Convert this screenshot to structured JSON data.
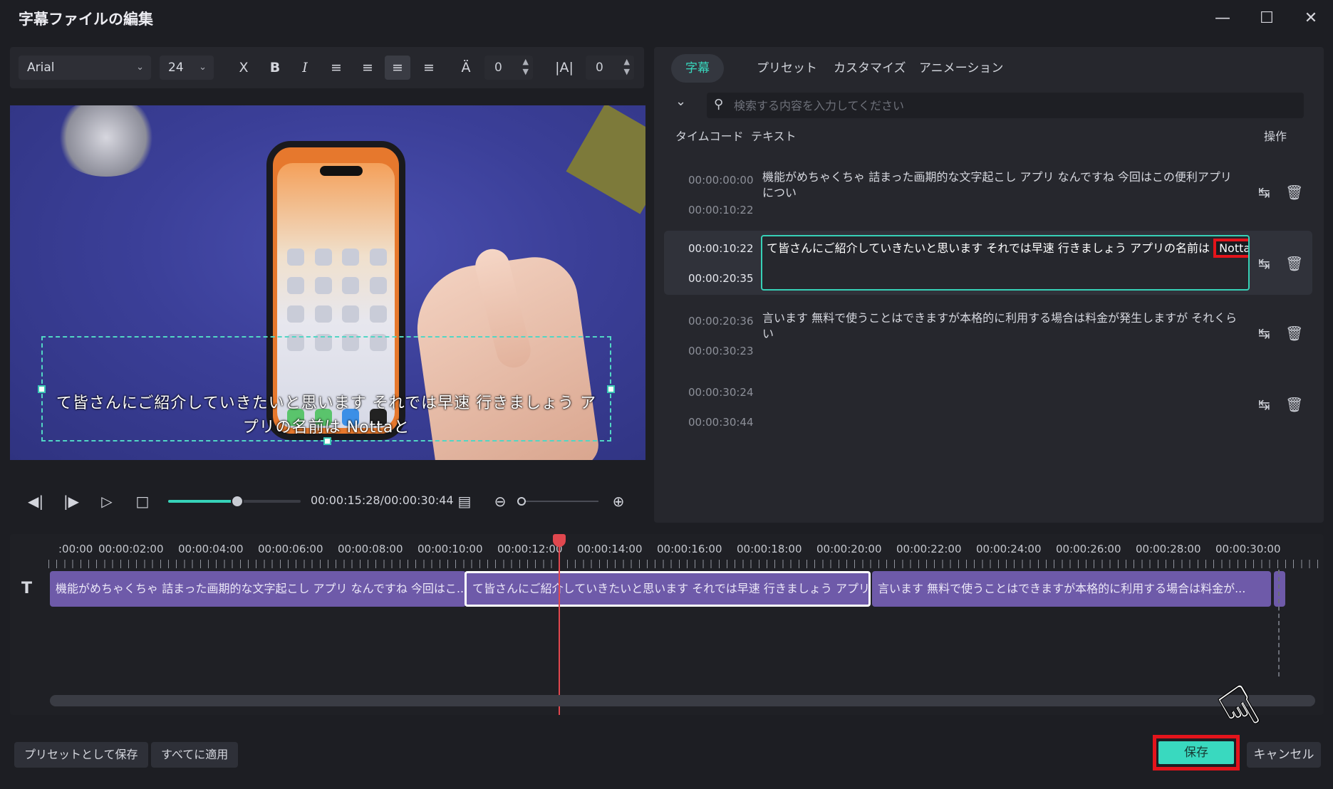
{
  "window": {
    "title": "字幕ファイルの編集"
  },
  "toolbar": {
    "font": "Arial",
    "size": "24",
    "letter_spacing": "0",
    "line_spacing": "0"
  },
  "preview": {
    "subtitle_line1": "て皆さんにご紹介していきたいと思います それでは早速 行きましょう ア",
    "subtitle_line2": "プリの名前は Nottaと"
  },
  "playback": {
    "timecode": "00:00:15:28/00:00:30:44",
    "progress": 0.52
  },
  "panel": {
    "tabs": [
      {
        "label": "字幕",
        "active": true
      },
      {
        "label": "プリセット"
      },
      {
        "label": "カスタマイズ"
      },
      {
        "label": "アニメーション"
      }
    ],
    "search_placeholder": "検索する内容を入力してください",
    "col_timecode": "タイムコード",
    "col_text": "テキスト",
    "col_actions": "操作",
    "rows": [
      {
        "start": "00:00:00:00",
        "end": "00:00:10:22",
        "text": "機能がめちゃくちゃ 詰まった画期的な文字起こし アプリ なんですね 今回はこの便利アプリについ"
      },
      {
        "start": "00:00:10:22",
        "end": "00:00:20:35",
        "text": "て皆さんにご紹介していきたいと思います それでは早速 行きましょう アプリの名前は",
        "highlight": "Notta"
      },
      {
        "start": "00:00:20:36",
        "end": "00:00:30:23",
        "text": "言います 無料で使うことはできますが本格的に利用する場合は料金が発生しますが それくらい"
      },
      {
        "start": "00:00:30:24",
        "end": "00:00:30:44",
        "text": ""
      }
    ]
  },
  "timeline": {
    "ruler": [
      ":00:00",
      "00:00:02:00",
      "00:00:04:00",
      "00:00:06:00",
      "00:00:08:00",
      "00:00:10:00",
      "00:00:12:00",
      "00:00:14:00",
      "00:00:16:00",
      "00:00:18:00",
      "00:00:20:00",
      "00:00:22:00",
      "00:00:24:00",
      "00:00:26:00",
      "00:00:28:00",
      "00:00:30:00"
    ],
    "clips": [
      "機能がめちゃくちゃ 詰まった画期的な文字起こし アプリ なんですね 今回はこ...",
      "て皆さんにご紹介していきたいと思います それでは早速 行きましょう アプリの...",
      "言います 無料で使うことはできますが本格的に利用する場合は料金が..."
    ]
  },
  "footer": {
    "save_preset": "プリセットとして保存",
    "apply_all": "すべてに適用",
    "save": "保存",
    "cancel": "キャンセル"
  },
  "colors": {
    "accent": "#39d9bf",
    "highlight": "#e4141b",
    "clip": "#6e5aa9"
  }
}
